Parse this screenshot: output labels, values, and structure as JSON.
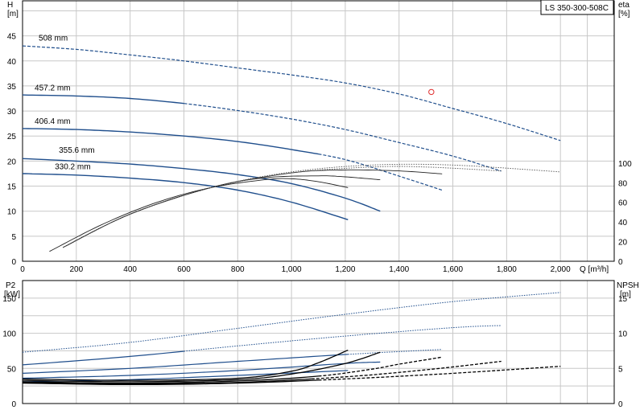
{
  "chart_data": {
    "type": "line",
    "model_label": "LS 350-300-508C",
    "grid": true,
    "colors": {
      "pump_curve": "#1f4e8c",
      "efficiency": "#000000",
      "npsh": "#000000",
      "operating_point": "#e03030"
    },
    "flow_axis": {
      "label": "Q [m³/h]",
      "xlim": [
        0,
        2200
      ],
      "ticks": [
        0,
        200,
        400,
        600,
        800,
        1000,
        1200,
        1400,
        1600,
        1800,
        2000
      ],
      "tick_labels": [
        "0",
        "200",
        "400",
        "600",
        "800",
        "1,000",
        "1,200",
        "1,400",
        "1,600",
        "1,800",
        "2,000"
      ]
    },
    "head_panel": {
      "ylabel_name": "H",
      "ylabel_unit": "[m]",
      "ylim": [
        0,
        52
      ],
      "yticks": [
        0,
        5,
        10,
        15,
        20,
        25,
        30,
        35,
        40,
        45
      ],
      "y2label_name": "eta",
      "y2label_unit": "[%]",
      "y2ticks": [
        0,
        20,
        40,
        60,
        80,
        100
      ],
      "y2_max": 100,
      "y2_top_value": 19.6,
      "series": [
        {
          "name": "508 mm",
          "x": [
            0,
            200,
            400,
            600,
            800,
            1000,
            1200,
            1400,
            1600,
            1800,
            2000
          ],
          "y": [
            43,
            42.3,
            41.2,
            40,
            38.6,
            37.2,
            35.6,
            33.4,
            30.5,
            27.5,
            24.1
          ],
          "solid_to": 0,
          "label_at": [
            60,
            43.6
          ]
        },
        {
          "name": "457.2 mm",
          "x": [
            0,
            200,
            400,
            600,
            800,
            1000,
            1200,
            1400,
            1600,
            1780
          ],
          "y": [
            33.2,
            33,
            32.5,
            31.5,
            30.1,
            28.4,
            26.3,
            23.7,
            21,
            18
          ],
          " solid_to": 0,
          "solid_end": 600,
          "label_at": [
            45,
            33.6
          ]
        },
        {
          "name": "406.4 mm",
          "x": [
            0,
            200,
            400,
            600,
            800,
            1000,
            1200,
            1400,
            1560
          ],
          "y": [
            26.5,
            26.3,
            25.8,
            25,
            23.9,
            22.3,
            20.3,
            17,
            14.2
          ],
          "solid_end": 1100,
          "label_at": [
            45,
            27
          ]
        },
        {
          "name": "355.6 mm",
          "x": [
            0,
            200,
            400,
            600,
            800,
            1000,
            1200,
            1330
          ],
          "y": [
            20.5,
            20,
            19.4,
            18.5,
            17.3,
            15.5,
            12.6,
            10
          ],
          "solid_end": 1330,
          "label_at": [
            135,
            21.2
          ]
        },
        {
          "name": "330.2 mm",
          "x": [
            0,
            200,
            400,
            600,
            800,
            1000,
            1210
          ],
          "y": [
            17.5,
            17.2,
            16.6,
            15.7,
            14.2,
            11.8,
            8.3
          ],
          "solid_end": 1210,
          "label_at": [
            120,
            17.9
          ]
        }
      ],
      "efficiency": [
        {
          "x": [
            100,
            300,
            500,
            700,
            900,
            1000,
            1100,
            1210
          ],
          "eta": [
            10,
            38,
            60,
            75,
            83,
            84,
            81,
            75
          ]
        },
        {
          "x": [
            150,
            400,
            700,
            900,
            1100,
            1200,
            1330
          ],
          "eta": [
            14,
            48,
            75,
            85,
            87,
            86,
            83
          ]
        },
        {
          "x": [
            150,
            400,
            700,
            1000,
            1200,
            1400,
            1560
          ],
          "eta": [
            14,
            48,
            75,
            90,
            93,
            92,
            89
          ]
        },
        {
          "x": [
            150,
            400,
            700,
            1000,
            1300,
            1500,
            1780
          ],
          "eta": [
            14,
            48,
            75,
            90,
            96,
            96,
            92
          ]
        },
        {
          "x": [
            150,
            400,
            700,
            1000,
            1300,
            1600,
            2000
          ],
          "eta": [
            14,
            48,
            75,
            91,
            98,
            98,
            91
          ]
        }
      ],
      "operating_point": {
        "x": 1520,
        "y": 33.8
      }
    },
    "power_panel": {
      "ylabel_name": "P2",
      "ylabel_unit": "[kW]",
      "ylim": [
        0,
        175
      ],
      "yticks": [
        0,
        50,
        100,
        150
      ],
      "y2label_name": "NPSH",
      "y2label_unit": "[m]",
      "y2ticks": [
        0,
        5,
        10,
        15
      ],
      "y2_max": 17.5,
      "power": [
        {
          "x": [
            0,
            400,
            800,
            1200,
            1600,
            2000
          ],
          "y": [
            73,
            87,
            107,
            127,
            145,
            158
          ],
          "solid_to": 0
        },
        {
          "x": [
            0,
            400,
            800,
            1200,
            1600,
            1780
          ],
          "y": [
            55,
            67,
            82,
            96,
            108,
            111
          ],
          "solid_to": 600
        },
        {
          "x": [
            0,
            400,
            800,
            1210,
            1560
          ],
          "y": [
            43,
            50,
            60,
            70,
            77
          ],
          "solid_to": 1210
        },
        {
          "x": [
            0,
            400,
            800,
            1200,
            1330
          ],
          "y": [
            36,
            40,
            47,
            57,
            59
          ],
          "solid_to": 1330
        },
        {
          "x": [
            0,
            400,
            800,
            1210
          ],
          "y": [
            31,
            34,
            40,
            47
          ],
          "solid_to": 1210
        }
      ],
      "npsh": [
        {
          "x": [
            0,
            400,
            800,
            1000,
            1100,
            1210
          ],
          "y": [
            3.5,
            3.3,
            3.6,
            4.6,
            5.8,
            7.6
          ]
        },
        {
          "x": [
            0,
            400,
            800,
            1000,
            1200,
            1330
          ],
          "y": [
            3.3,
            3.1,
            3.4,
            4.2,
            5.7,
            7.3
          ]
        },
        {
          "x": [
            0,
            400,
            800,
            1100,
            1300,
            1400,
            1560
          ],
          "y": [
            3.1,
            2.9,
            3.2,
            3.9,
            4.9,
            5.6,
            6.6
          ]
        },
        {
          "x": [
            0,
            400,
            800,
            1200,
            1500,
            1780
          ],
          "y": [
            3,
            2.8,
            3,
            3.8,
            4.8,
            6
          ]
        },
        {
          "x": [
            0,
            400,
            800,
            1200,
            1600,
            2000
          ],
          "y": [
            2.9,
            2.7,
            2.9,
            3.5,
            4.3,
            5.3
          ]
        }
      ]
    }
  }
}
